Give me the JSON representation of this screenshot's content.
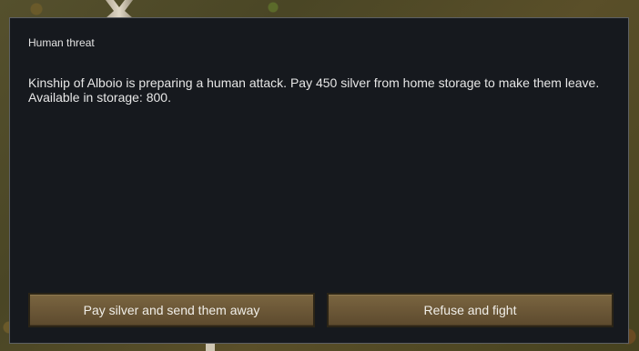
{
  "dialog": {
    "title": "Human threat",
    "message_line1": "Kinship of Alboio is preparing a human attack. Pay 450 silver from home storage to make them leave.",
    "message_line2": "Available in storage: 800.",
    "buttons": {
      "pay_label": "Pay silver and send them away",
      "refuse_label": "Refuse and fight"
    }
  }
}
